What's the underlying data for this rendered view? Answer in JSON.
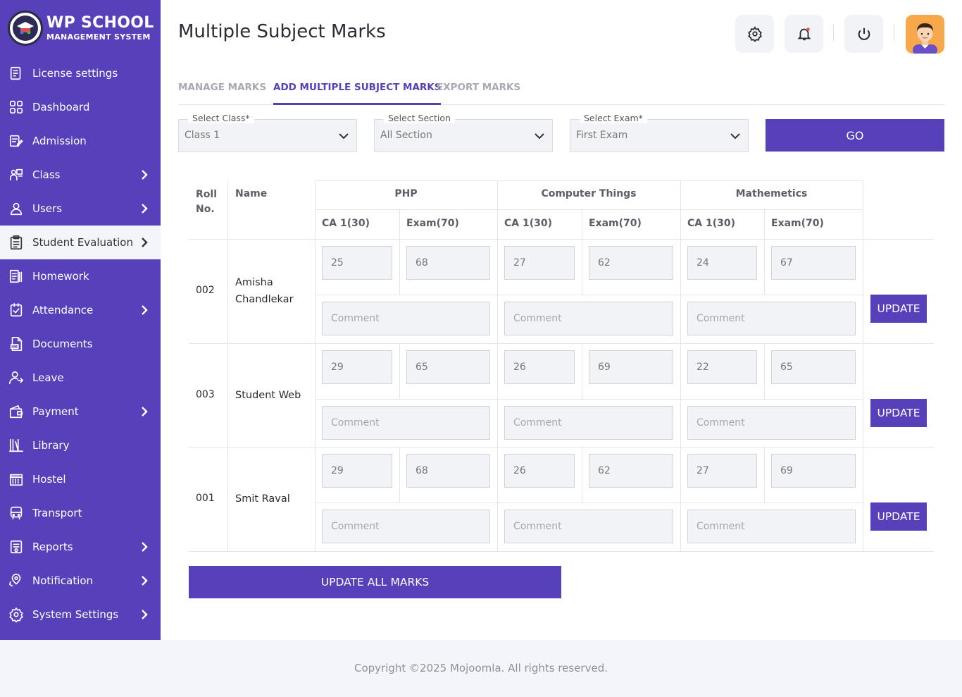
{
  "brand": {
    "title": "WP SCHOOL",
    "subtitle": "MANAGEMENT SYSTEM"
  },
  "sidebar": {
    "items": [
      {
        "label": "License settings",
        "icon": "license-icon",
        "has_chevron": false
      },
      {
        "label": "Dashboard",
        "icon": "dashboard-grid-icon",
        "has_chevron": false
      },
      {
        "label": "Admission",
        "icon": "admission-form-icon",
        "has_chevron": false
      },
      {
        "label": "Class",
        "icon": "class-people-icon",
        "has_chevron": true
      },
      {
        "label": "Users",
        "icon": "user-icon",
        "has_chevron": true
      },
      {
        "label": "Student Evaluation",
        "icon": "evaluation-clipboard-icon",
        "has_chevron": true,
        "active": true
      },
      {
        "label": "Homework",
        "icon": "homework-icon",
        "has_chevron": false
      },
      {
        "label": "Attendance",
        "icon": "attendance-check-icon",
        "has_chevron": true
      },
      {
        "label": "Documents",
        "icon": "document-icon",
        "has_chevron": false
      },
      {
        "label": "Leave",
        "icon": "leave-user-icon",
        "has_chevron": false
      },
      {
        "label": "Payment",
        "icon": "wallet-icon",
        "has_chevron": true
      },
      {
        "label": "Library",
        "icon": "library-books-icon",
        "has_chevron": false
      },
      {
        "label": "Hostel",
        "icon": "hostel-building-icon",
        "has_chevron": false
      },
      {
        "label": "Transport",
        "icon": "bus-icon",
        "has_chevron": false
      },
      {
        "label": "Reports",
        "icon": "report-icon",
        "has_chevron": true
      },
      {
        "label": "Notification",
        "icon": "notification-pin-icon",
        "has_chevron": true
      },
      {
        "label": "System Settings",
        "icon": "settings-gear-icon",
        "has_chevron": true
      }
    ]
  },
  "header": {
    "title": "Multiple Subject Marks"
  },
  "tabs": [
    {
      "label": "MANAGE MARKS",
      "active": false
    },
    {
      "label": "ADD MULTIPLE SUBJECT MARKS",
      "active": true
    },
    {
      "label": "EXPORT MARKS",
      "active": false
    }
  ],
  "filters": {
    "class": {
      "label": "Select Class*",
      "value": "Class 1"
    },
    "section": {
      "label": "Select Section",
      "value": "All Section"
    },
    "exam": {
      "label": "Select Exam*",
      "value": "First Exam"
    },
    "go_label": "GO"
  },
  "table": {
    "headers": {
      "roll": "Roll No.",
      "name": "Name"
    },
    "subjects": [
      {
        "name": "PHP",
        "col1": "CA 1(30)",
        "col2": "Exam(70)"
      },
      {
        "name": "Computer Things",
        "col1": "CA 1(30)",
        "col2": "Exam(70)"
      },
      {
        "name": "Mathemetics",
        "col1": "CA 1(30)",
        "col2": "Exam(70)"
      }
    ],
    "comment_placeholder": "Comment",
    "update_label": "UPDATE",
    "rows": [
      {
        "roll": "002",
        "name": "Amisha Chandlekar",
        "marks": [
          "25",
          "68",
          "27",
          "62",
          "24",
          "67"
        ]
      },
      {
        "roll": "003",
        "name": "Student Web",
        "marks": [
          "29",
          "65",
          "26",
          "69",
          "22",
          "65"
        ]
      },
      {
        "roll": "001",
        "name": "Smit Raval",
        "marks": [
          "29",
          "68",
          "26",
          "62",
          "27",
          "69"
        ]
      }
    ]
  },
  "update_all_label": "UPDATE ALL MARKS",
  "footer": {
    "copyright": "Copyright ©2025 Mojoomla. All rights reserved."
  },
  "colors": {
    "primary": "#5840bb",
    "background": "#f3f5fa",
    "input_bg": "#f1f3f7"
  }
}
